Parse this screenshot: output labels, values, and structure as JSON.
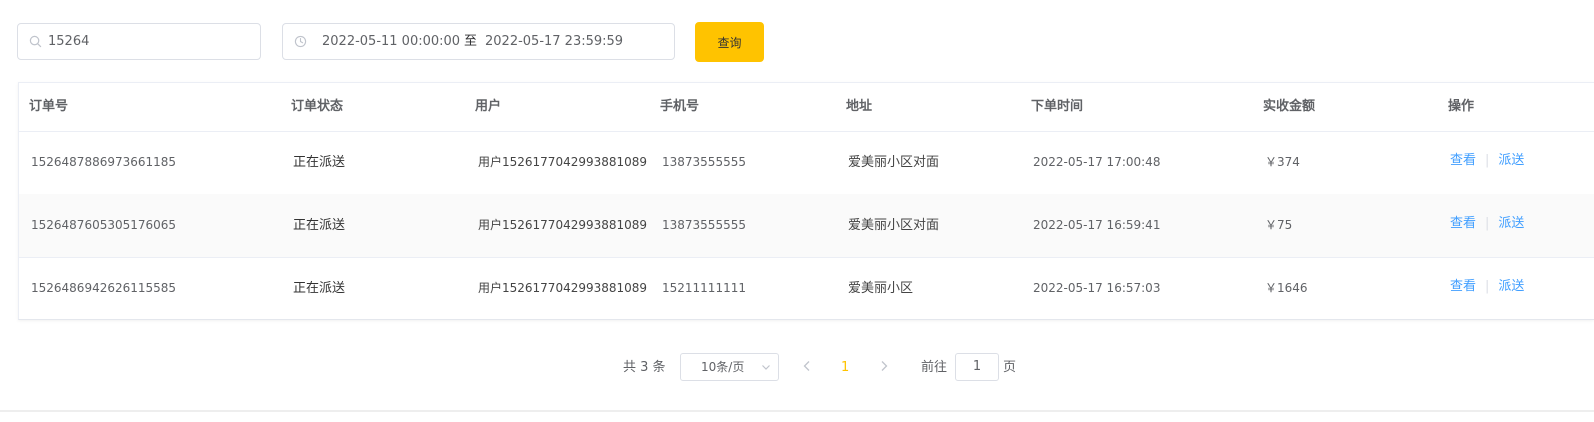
{
  "filters": {
    "search_value": "15264",
    "date_start": "2022-05-11 00:00:00",
    "date_separator": "至",
    "date_end": "2022-05-17 23:59:59",
    "query_label": "查询"
  },
  "table": {
    "columns": [
      "订单号",
      "订单状态",
      "用户",
      "手机号",
      "地址",
      "下单时间",
      "实收金额",
      "操作"
    ],
    "rows": [
      {
        "order_no": "1526487886973661185",
        "status": "正在派送",
        "user": "用户1526177042993881089",
        "phone": "13873555555",
        "address": "爱美丽小区对面",
        "order_time": "2022-05-17 17:00:48",
        "amount": "￥374",
        "actions": [
          "查看",
          "派送"
        ]
      },
      {
        "order_no": "1526487605305176065",
        "status": "正在派送",
        "user": "用户1526177042993881089",
        "phone": "13873555555",
        "address": "爱美丽小区对面",
        "order_time": "2022-05-17 16:59:41",
        "amount": "￥75",
        "actions": [
          "查看",
          "派送"
        ]
      },
      {
        "order_no": "1526486942626115585",
        "status": "正在派送",
        "user": "用户1526177042993881089",
        "phone": "15211111111",
        "address": "爱美丽小区",
        "order_time": "2022-05-17 16:57:03",
        "amount": "￥1646",
        "actions": [
          "查看",
          "派送"
        ]
      }
    ]
  },
  "pagination": {
    "total": "共 3 条",
    "page_size": "10条/页",
    "current_page": "1",
    "goto_label": "前往",
    "goto_value": "1",
    "page_unit": "页"
  },
  "colors": {
    "accent": "#ffc300",
    "link": "#409eff"
  },
  "icons": {
    "search": "search-icon",
    "clock": "clock-icon",
    "chevron_down": "chevron-down-icon",
    "prev": "chevron-left-icon",
    "next": "chevron-right-icon"
  }
}
